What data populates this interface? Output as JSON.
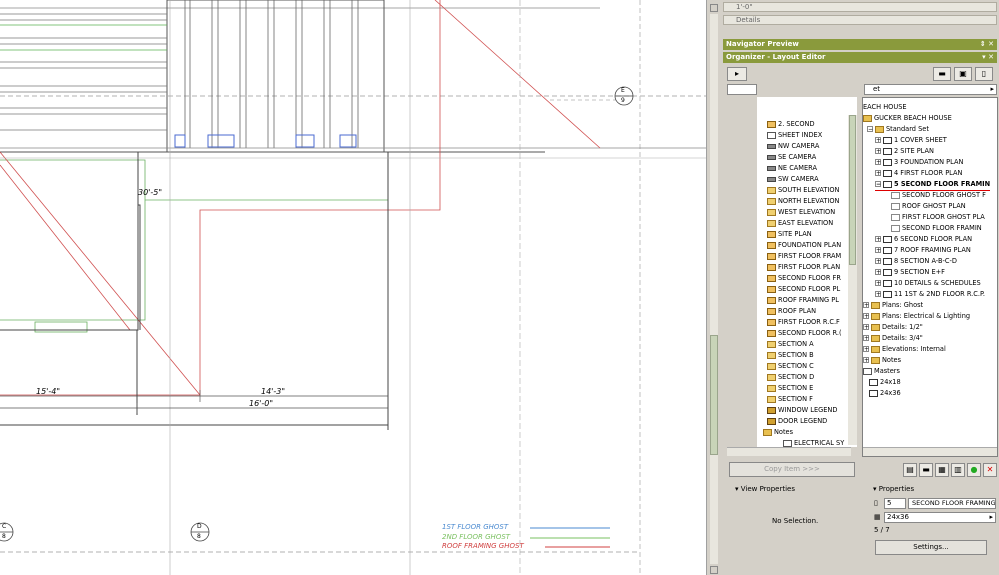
{
  "drawing": {
    "dimensions": [
      "30'-5\"",
      "15'-4\"",
      "14'-3\"",
      "16'-0\""
    ],
    "markers": [
      {
        "letter": "E",
        "num": "9"
      },
      {
        "letter": "C",
        "num": "8"
      },
      {
        "letter": "D",
        "num": "8"
      }
    ],
    "legend": [
      "1ST FLOOR GHOST",
      "2ND FLOOR GHOST",
      "ROOF FRAMING GHOST"
    ],
    "legend_colors": [
      "#4a8ad0",
      "#7ac060",
      "#d04040"
    ]
  },
  "panel": {
    "top_field_1": "1'-0\"",
    "top_field_2": "Details",
    "navigator_title": "Navigator Preview",
    "organizer_title": "Organizer - Layout Editor",
    "left_dropdown_text": "",
    "right_dropdown_text": "et",
    "left_tree": [
      "2. SECOND",
      "SHEET INDEX",
      "NW CAMERA",
      "SE CAMERA",
      "NE CAMERA",
      "SW CAMERA",
      "SOUTH ELEVATION",
      "NORTH ELEVATION",
      "WEST ELEVATION",
      "EAST ELEVATION",
      "SITE PLAN",
      "FOUNDATION PLAN",
      "FIRST FLOOR FRAM",
      "FIRST FLOOR PLAN",
      "SECOND FLOOR FR",
      "SECOND FLOOR PL",
      "ROOF FRAMING PL",
      "ROOF PLAN",
      "FIRST FLOOR R.C.F",
      "SECOND FLOOR R.(",
      "SECTION A",
      "SECTION B",
      "SECTION C",
      "SECTION D",
      "SECTION E",
      "SECTION F",
      "WINDOW LEGEND",
      "DOOR LEGEND",
      "Notes",
      "ELECTRICAL SY"
    ],
    "right_tree": [
      "EACH HOUSE",
      "GUCKER BEACH HOUSE",
      "Standard Set",
      "1 COVER SHEET",
      "2 SITE PLAN",
      "3 FOUNDATION PLAN",
      "4 FIRST FLOOR PLAN",
      "5 SECOND FLOOR FRAMIN",
      "SECOND FLOOR GHOST F",
      "ROOF GHOST PLAN",
      "FIRST FLOOR GHOST PLA",
      "SECOND FLOOR FRAMIN",
      "6 SECOND FLOOR PLAN",
      "7 ROOF FRAMING PLAN",
      "8 SECTION A-B-C-D",
      "9 SECTION E+F",
      "10 DETAILS & SCHEDULES",
      "11 1ST & 2ND FLOOR R.C.P.",
      "Plans: Ghost",
      "Plans: Electrical & Lighting",
      "Details: 1/2\"",
      "Details: 3/4\"",
      "Elevations: Internal",
      "Notes",
      "Masters",
      "24x18",
      "24x36"
    ],
    "copy_button": "Copy Item >>>",
    "view_properties": "View Properties",
    "no_selection": "No Selection.",
    "properties": "Properties",
    "prop_number": "5",
    "prop_name": "SECOND FLOOR FRAMING",
    "prop_master": "24x36",
    "prop_page": "5 / 7",
    "settings_button": "Settings..."
  }
}
